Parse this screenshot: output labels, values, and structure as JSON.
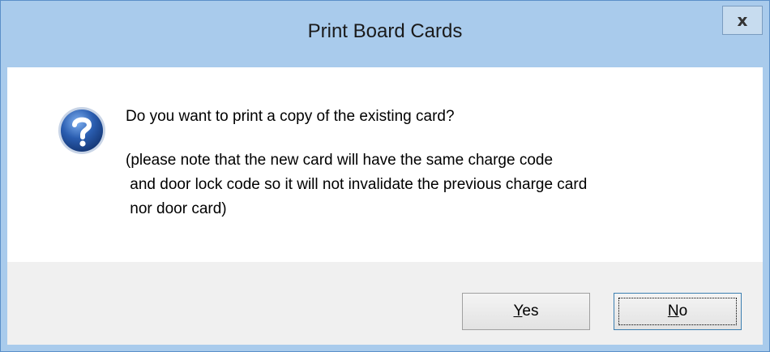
{
  "dialog": {
    "title": "Print Board Cards",
    "close_glyph": "x",
    "icon": "question-icon",
    "message": {
      "line1": "Do you want to print a copy of the existing card?",
      "line2": "(please note that the new card will have the same charge code",
      "line3": " and door lock code so it will not invalidate the previous charge card",
      "line4": " nor door card)"
    },
    "buttons": {
      "yes_mnemonic": "Y",
      "yes_rest": "es",
      "no_mnemonic": "N",
      "no_rest": "o"
    }
  },
  "colors": {
    "titlebar": "#a9cbec",
    "border": "#5b8fc9",
    "icon_blue": "#2a5db0",
    "footer": "#f0f0f0"
  }
}
